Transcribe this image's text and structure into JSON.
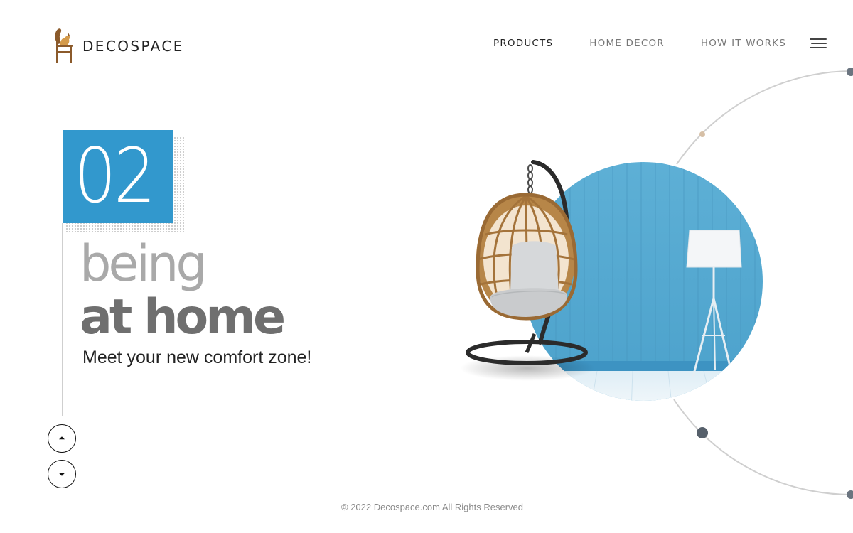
{
  "header": {
    "brand": "DECOSPACE",
    "logo_icon": "squirrel-on-chair-icon",
    "nav": [
      {
        "label": "PRODUCTS",
        "active": true
      },
      {
        "label": "HOME DECOR",
        "active": false
      },
      {
        "label": "HOW IT WORKS",
        "active": false
      }
    ],
    "menu_icon": "hamburger-menu-icon"
  },
  "hero": {
    "slide_number": "02",
    "headline_light": "being",
    "headline_bold": "at home",
    "tagline": "Meet your new comfort zone!"
  },
  "slider_controls": {
    "up_icon": "caret-up-icon",
    "down_icon": "caret-down-icon"
  },
  "footer": {
    "copyright": "© 2022 Decospace.com All Rights Reserved"
  },
  "colors": {
    "accent_blue": "#3298cd",
    "headline_light": "#a9a9a9",
    "headline_bold": "#6f6f6f",
    "logo_brown": "#8b5a2b"
  }
}
